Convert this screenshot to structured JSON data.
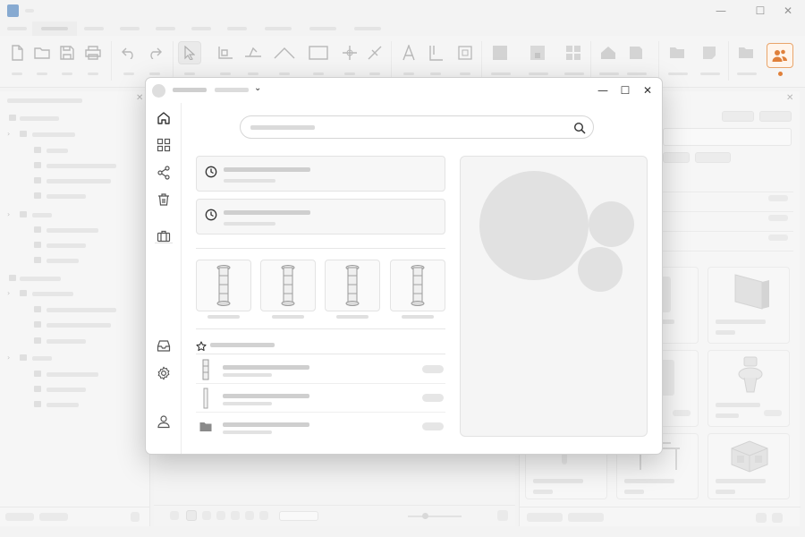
{
  "app": {
    "title": "",
    "window_controls": {
      "minimize": "—",
      "maximize": "☐",
      "close": "✕"
    },
    "brand_color": "#2f6fb6",
    "accent_color": "#e0803a"
  },
  "menu": {
    "items": [
      "",
      "",
      "",
      "",
      "",
      "",
      "",
      "",
      "",
      "",
      "",
      ""
    ],
    "active_index": 1
  },
  "ribbon": {
    "buttons": [
      {
        "icon": "new-file-icon"
      },
      {
        "icon": "open-folder-icon"
      },
      {
        "icon": "save-icon"
      },
      {
        "icon": "print-icon"
      },
      {
        "icon": "undo-icon"
      },
      {
        "icon": "redo-icon"
      },
      {
        "icon": "select-pointer-icon"
      },
      {
        "icon": "wall-tool-icon"
      },
      {
        "icon": "floor-tool-icon"
      },
      {
        "icon": "roof-tool-icon"
      },
      {
        "icon": "rectangle-tool-icon"
      },
      {
        "icon": "snap-tool-icon"
      },
      {
        "icon": "trim-tool-icon"
      },
      {
        "icon": "text-tool-icon"
      },
      {
        "icon": "dimension-tool-icon"
      },
      {
        "icon": "group-tool-icon"
      },
      {
        "icon": "block-icon"
      },
      {
        "icon": "library-icon"
      },
      {
        "icon": "layout-icon"
      },
      {
        "icon": "home-icon"
      },
      {
        "icon": "component-icon"
      },
      {
        "icon": "folder-icon"
      },
      {
        "icon": "note-icon"
      },
      {
        "icon": "folder-alt-icon"
      },
      {
        "icon": "collaborate-icon"
      }
    ]
  },
  "left_panel": {
    "close": "✕",
    "tree_chevron": "›"
  },
  "dialog": {
    "window_controls": {
      "minimize": "—",
      "maximize": "☐",
      "close": "✕"
    },
    "project_caret": "⌄",
    "search": {
      "placeholder": ""
    },
    "sidebar": [
      {
        "icon": "home-icon",
        "name": "home"
      },
      {
        "icon": "grid-icon",
        "name": "browse"
      },
      {
        "icon": "share-icon",
        "name": "shared"
      },
      {
        "icon": "trash-icon",
        "name": "trash"
      },
      {
        "icon": "briefcase-icon",
        "name": "projects"
      },
      {
        "icon": "inbox-icon",
        "name": "inbox"
      },
      {
        "icon": "settings-icon",
        "name": "settings"
      },
      {
        "icon": "user-icon",
        "name": "account"
      }
    ],
    "recent": [
      {
        "icon": "clock-icon"
      },
      {
        "icon": "clock-icon"
      }
    ],
    "models": [
      {
        "icon": "column-model-icon"
      },
      {
        "icon": "column-model-icon"
      },
      {
        "icon": "column-model-icon"
      },
      {
        "icon": "column-model-icon"
      }
    ],
    "favorites": {
      "icon": "star-icon",
      "items": [
        {
          "icon": "column-model-icon"
        },
        {
          "icon": "panel-model-icon"
        },
        {
          "icon": "folder-icon"
        }
      ]
    }
  }
}
